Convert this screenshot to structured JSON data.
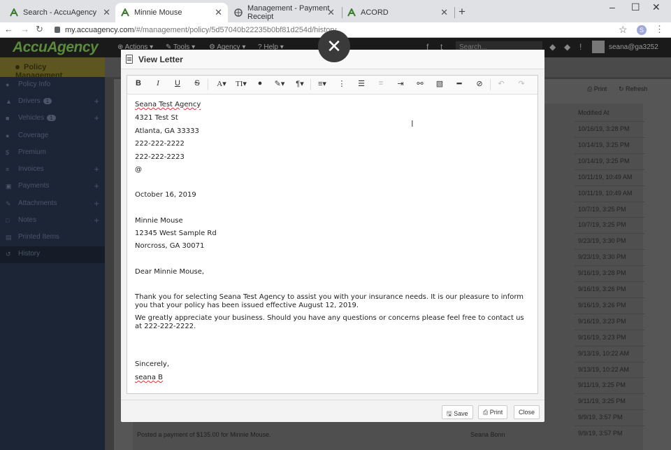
{
  "browser": {
    "tabs": [
      {
        "title": "Search - AccuAgency",
        "active": false
      },
      {
        "title": "Minnie Mouse",
        "active": true
      },
      {
        "title": "Management - Payment Receipt",
        "active": false
      },
      {
        "title": "ACORD",
        "active": false
      }
    ],
    "url_host": "my.accuagency.com",
    "url_path": "/#/management/policy/5d57040b22235b0bf81d254d/history",
    "profile_initial": "S"
  },
  "app": {
    "logo": "AccuAgency",
    "menu": [
      "Actions",
      "Tools",
      "Agency",
      "Help"
    ],
    "search_placeholder": "Search...",
    "user_email": "seana@ga3252"
  },
  "sidebar": {
    "header": "Policy Management",
    "items": [
      {
        "label": "Policy Info",
        "icon": "info-icon",
        "plus": false,
        "badge": ""
      },
      {
        "label": "Drivers",
        "icon": "users-icon",
        "plus": true,
        "badge": "1"
      },
      {
        "label": "Vehicles",
        "icon": "car-icon",
        "plus": true,
        "badge": "1"
      },
      {
        "label": "Coverage",
        "icon": "circle-icon",
        "plus": false,
        "badge": ""
      },
      {
        "label": "Premium",
        "icon": "dollar-icon",
        "plus": false,
        "badge": ""
      },
      {
        "label": "Invoices",
        "icon": "list-icon",
        "plus": true,
        "badge": ""
      },
      {
        "label": "Payments",
        "icon": "money-icon",
        "plus": true,
        "badge": ""
      },
      {
        "label": "Attachments",
        "icon": "paperclip-icon",
        "plus": true,
        "badge": ""
      },
      {
        "label": "Notes",
        "icon": "note-icon",
        "plus": true,
        "badge": ""
      },
      {
        "label": "Printed Items",
        "icon": "printer-icon",
        "plus": false,
        "badge": ""
      },
      {
        "label": "History",
        "icon": "history-icon",
        "plus": false,
        "badge": ""
      }
    ]
  },
  "history": {
    "print_label": "Print",
    "refresh_label": "Refresh",
    "modified_header": "Modified At",
    "dates": [
      "10/16/19, 3:28 PM",
      "10/14/19, 3:25 PM",
      "10/14/19, 3:25 PM",
      "10/11/19, 10:49 AM",
      "10/11/19, 10:49 AM",
      "10/7/19, 3:25 PM",
      "10/7/19, 3:25 PM",
      "9/23/19, 3:30 PM",
      "9/23/19, 3:30 PM",
      "9/16/19, 3:28 PM",
      "9/16/19, 3:26 PM",
      "9/16/19, 3:26 PM",
      "9/16/19, 3:23 PM",
      "9/16/19, 3:23 PM",
      "9/13/19, 10:22 AM",
      "9/13/19, 10:22 AM",
      "9/11/19, 3:25 PM",
      "9/11/19, 3:25 PM",
      "9/9/19, 3:57 PM",
      "9/9/19, 3:57 PM"
    ],
    "visible_row_text": "Posted a payment of $135.00 for Minnie Mouse.",
    "visible_row_user": "Seana Bonn"
  },
  "modal": {
    "title": "View Letter",
    "letter": {
      "agency_name": "Seana Test Agency",
      "address1": "4321 Test St",
      "address2": "Atlanta, GA 33333",
      "phone1": "222-222-2222",
      "phone2": "222-222-2223",
      "email": "@",
      "date": "October 16, 2019",
      "recipient": "Minnie Mouse",
      "recipient_addr1": "12345 West Sample Rd",
      "recipient_addr2": "Norcross, GA 30071",
      "greeting": "Dear Minnie Mouse,",
      "para1": "Thank you for selecting Seana Test Agency to assist you with your insurance needs.  It is our pleasure to inform you that your policy has been issued effective August 12, 2019.",
      "para2": "We greatly appreciate your business.  Should you have any questions or concerns please feel free to contact us at 222-222-2222.",
      "closing": "Sincerely,",
      "signature": "seana B"
    },
    "buttons": {
      "save": "Save",
      "print": "Print",
      "close": "Close"
    }
  }
}
